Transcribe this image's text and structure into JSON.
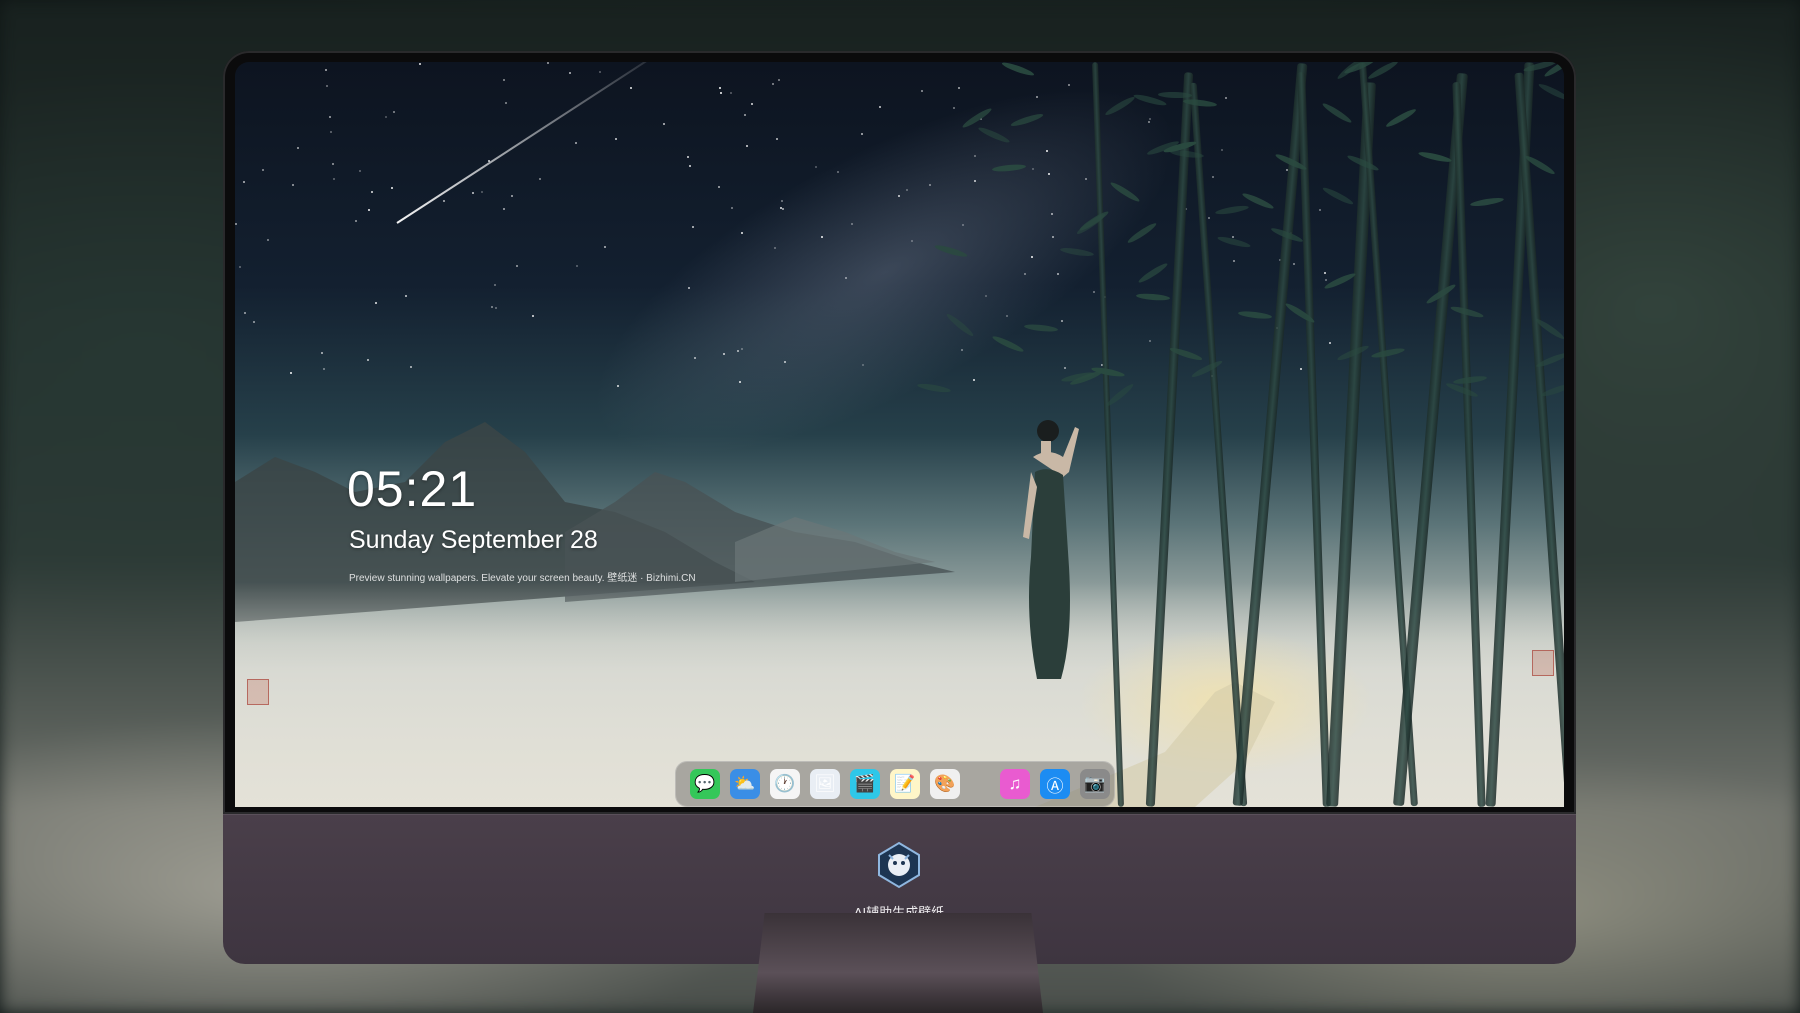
{
  "lockscreen": {
    "time": "05:21",
    "date": "Sunday September  28",
    "tagline": "Preview stunning wallpapers. Elevate your screen beauty. 壁纸迷 · Bizhimi.CN"
  },
  "dock": {
    "apps": [
      {
        "name": "messages",
        "icon": "messages-icon",
        "color": "#34c759",
        "glyph": "💬"
      },
      {
        "name": "weather",
        "icon": "weather-icon",
        "color": "#3a8ee6",
        "glyph": "⛅"
      },
      {
        "name": "clock",
        "icon": "clock-icon",
        "color": "#f5f5f5",
        "glyph": "🕐"
      },
      {
        "name": "preview",
        "icon": "preview-icon",
        "color": "#e9eef4",
        "glyph": "🖼"
      },
      {
        "name": "clips",
        "icon": "clapperboard-icon",
        "color": "#2ec7e8",
        "glyph": "🎬"
      },
      {
        "name": "notes",
        "icon": "notes-icon",
        "color": "#fff6c8",
        "glyph": "📝"
      },
      {
        "name": "photo-booth",
        "icon": "photo-booth-icon",
        "color": "#f0f0f0",
        "glyph": "🎨"
      },
      {
        "name": "itunes",
        "icon": "itunes-icon",
        "color": "#e95bd0",
        "glyph": "♫"
      },
      {
        "name": "app-store",
        "icon": "app-store-icon",
        "color": "#1c8cf2",
        "glyph": "Ⓐ"
      },
      {
        "name": "camera",
        "icon": "camera-icon",
        "color": "#8a8a8a",
        "glyph": "📷"
      }
    ]
  },
  "monitor": {
    "brand_label": "AI辅助生成壁纸"
  }
}
